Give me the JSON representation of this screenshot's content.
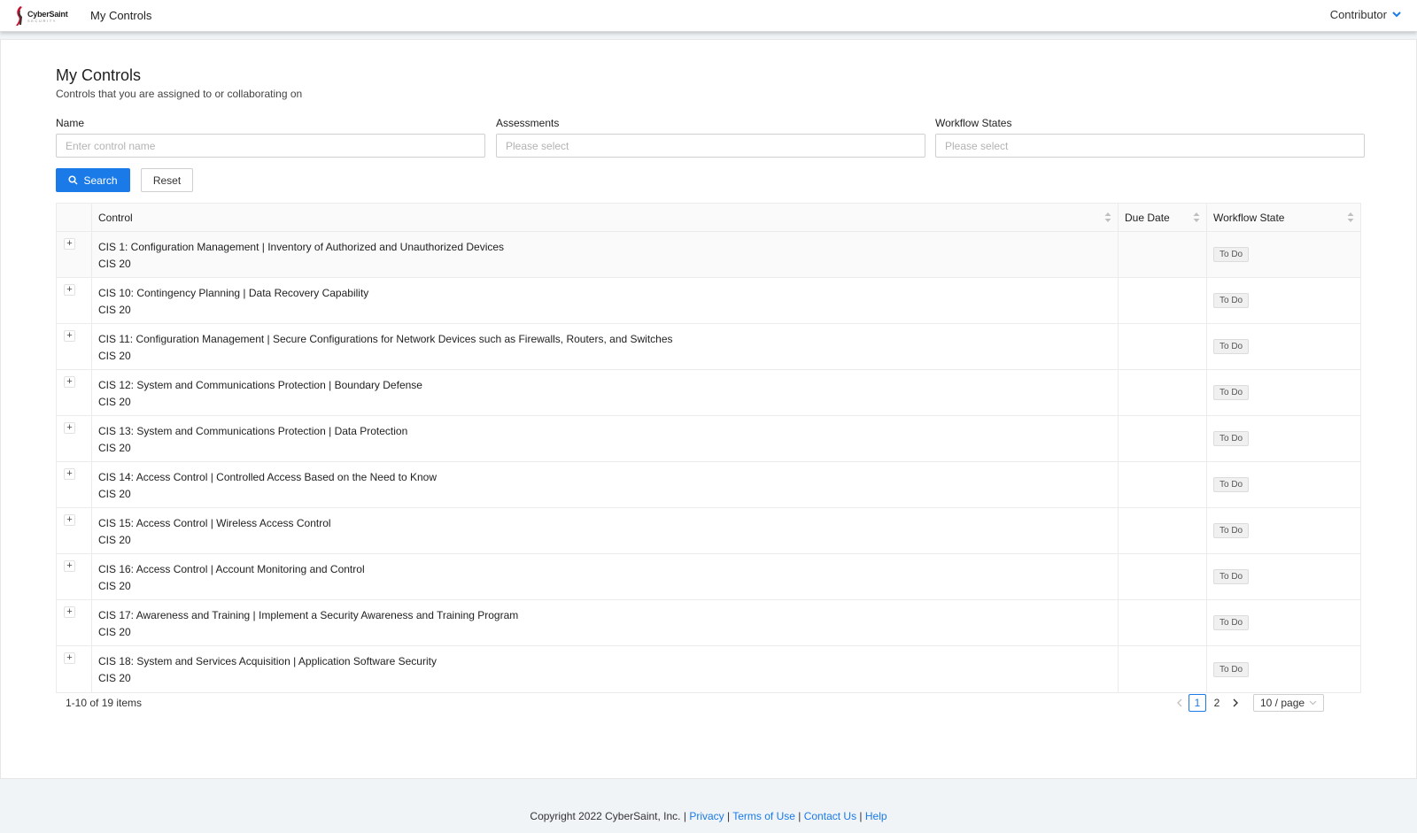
{
  "header": {
    "logo_name": "CyberSaint",
    "logo_sub": "SECURITY",
    "app_title": "My Controls",
    "user_role": "Contributor"
  },
  "page": {
    "title": "My Controls",
    "subtitle": "Controls that you are assigned to or collaborating on"
  },
  "filters": {
    "name_label": "Name",
    "name_placeholder": "Enter control name",
    "assessments_label": "Assessments",
    "assessments_placeholder": "Please select",
    "workflow_label": "Workflow States",
    "workflow_placeholder": "Please select",
    "search_label": "Search",
    "reset_label": "Reset"
  },
  "table": {
    "columns": [
      "Control",
      "Due Date",
      "Workflow State"
    ],
    "rows": [
      {
        "control": "CIS 1: Configuration Management | Inventory of Authorized and Unauthorized Devices",
        "framework": "CIS 20",
        "due": "",
        "state": "To Do"
      },
      {
        "control": "CIS 10: Contingency Planning | Data Recovery Capability",
        "framework": "CIS 20",
        "due": "",
        "state": "To Do"
      },
      {
        "control": "CIS 11: Configuration Management | Secure Configurations for Network Devices such as Firewalls, Routers, and Switches",
        "framework": "CIS 20",
        "due": "",
        "state": "To Do"
      },
      {
        "control": "CIS 12: System and Communications Protection | Boundary Defense",
        "framework": "CIS 20",
        "due": "",
        "state": "To Do"
      },
      {
        "control": "CIS 13: System and Communications Protection | Data Protection",
        "framework": "CIS 20",
        "due": "",
        "state": "To Do"
      },
      {
        "control": "CIS 14: Access Control | Controlled Access Based on the Need to Know",
        "framework": "CIS 20",
        "due": "",
        "state": "To Do"
      },
      {
        "control": "CIS 15: Access Control | Wireless Access Control",
        "framework": "CIS 20",
        "due": "",
        "state": "To Do"
      },
      {
        "control": "CIS 16: Access Control | Account Monitoring and Control",
        "framework": "CIS 20",
        "due": "",
        "state": "To Do"
      },
      {
        "control": "CIS 17: Awareness and Training | Implement a Security Awareness and Training Program",
        "framework": "CIS 20",
        "due": "",
        "state": "To Do"
      },
      {
        "control": "CIS 18: System and Services Acquisition | Application Software Security",
        "framework": "CIS 20",
        "due": "",
        "state": "To Do"
      }
    ]
  },
  "pagination": {
    "total_text": "1-10 of 19 items",
    "pages": [
      "1",
      "2"
    ],
    "current_page": "1",
    "page_size": "10 / page"
  },
  "footer": {
    "copyright": "Copyright 2022 CyberSaint, Inc.",
    "links": [
      "Privacy",
      "Terms of Use",
      "Contact Us",
      "Help"
    ]
  },
  "colors": {
    "accent": "#1a7ae8",
    "logo_red": "#c8102e"
  }
}
